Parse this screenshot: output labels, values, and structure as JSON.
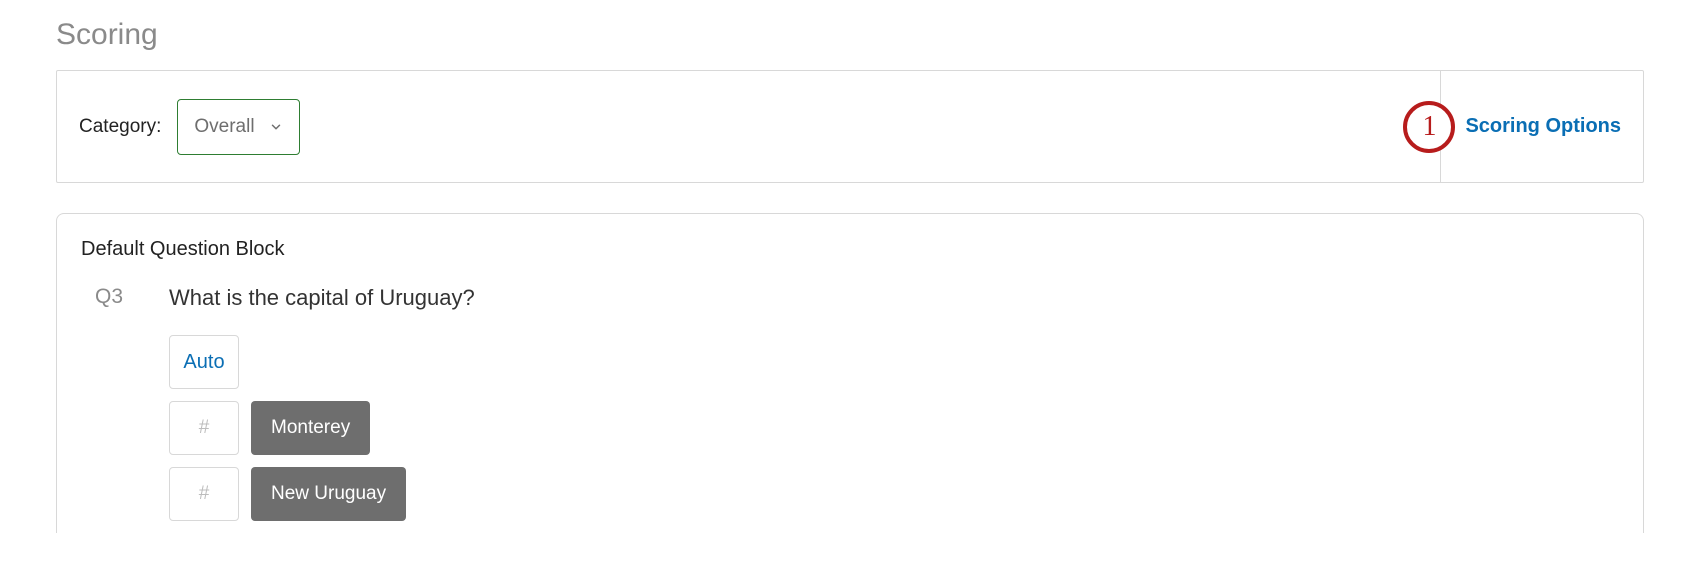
{
  "header": {
    "title": "Scoring"
  },
  "categoryBar": {
    "label": "Category:",
    "selectedValue": "Overall",
    "scoringOptionsLabel": "Scoring Options",
    "annotationNumber": "1"
  },
  "block": {
    "title": "Default Question Block",
    "question": {
      "id": "Q3",
      "text": "What is the capital of Uruguay?",
      "autoLabel": "Auto",
      "answers": [
        {
          "scorePlaceholder": "#",
          "label": "Monterey"
        },
        {
          "scorePlaceholder": "#",
          "label": "New Uruguay"
        }
      ]
    }
  }
}
